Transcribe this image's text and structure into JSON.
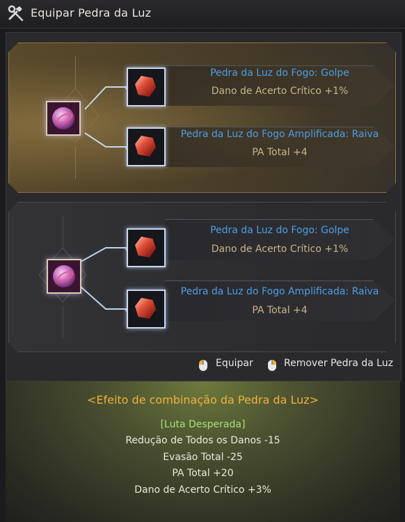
{
  "window": {
    "title": "Equipar Pedra da Luz",
    "icon": "tools-icon"
  },
  "sets": [
    {
      "state": "active",
      "slots": [
        {
          "name": "Pedra da Luz do Fogo: Golpe",
          "effect": "Dano de Acerto Crítico +1%"
        },
        {
          "name": "Pedra da Luz do Fogo Amplificada: Raiva",
          "effect": "PA Total +4"
        }
      ]
    },
    {
      "state": "inactive",
      "slots": [
        {
          "name": "Pedra da Luz do Fogo: Golpe",
          "effect": "Dano de Acerto Crítico +1%"
        },
        {
          "name": "Pedra da Luz do Fogo Amplificada: Raiva",
          "effect": "PA Total +4"
        }
      ]
    }
  ],
  "hints": {
    "equip": "Equipar",
    "remove": "Remover Pedra da Luz"
  },
  "combination": {
    "title": "<Efeito de combinação da Pedra da Luz>",
    "name": "[Luta Desperada]",
    "effects": [
      "Redução de Todos os Danos -15",
      "Evasão Total -25",
      "PA Total +20",
      "Dano de Acerto Crítico +3%"
    ]
  },
  "colors": {
    "stone_name": "#4d9ee6",
    "stone_effect": "#c9b48a",
    "combo_title": "#f0b040",
    "combo_name": "#a6e07a"
  }
}
